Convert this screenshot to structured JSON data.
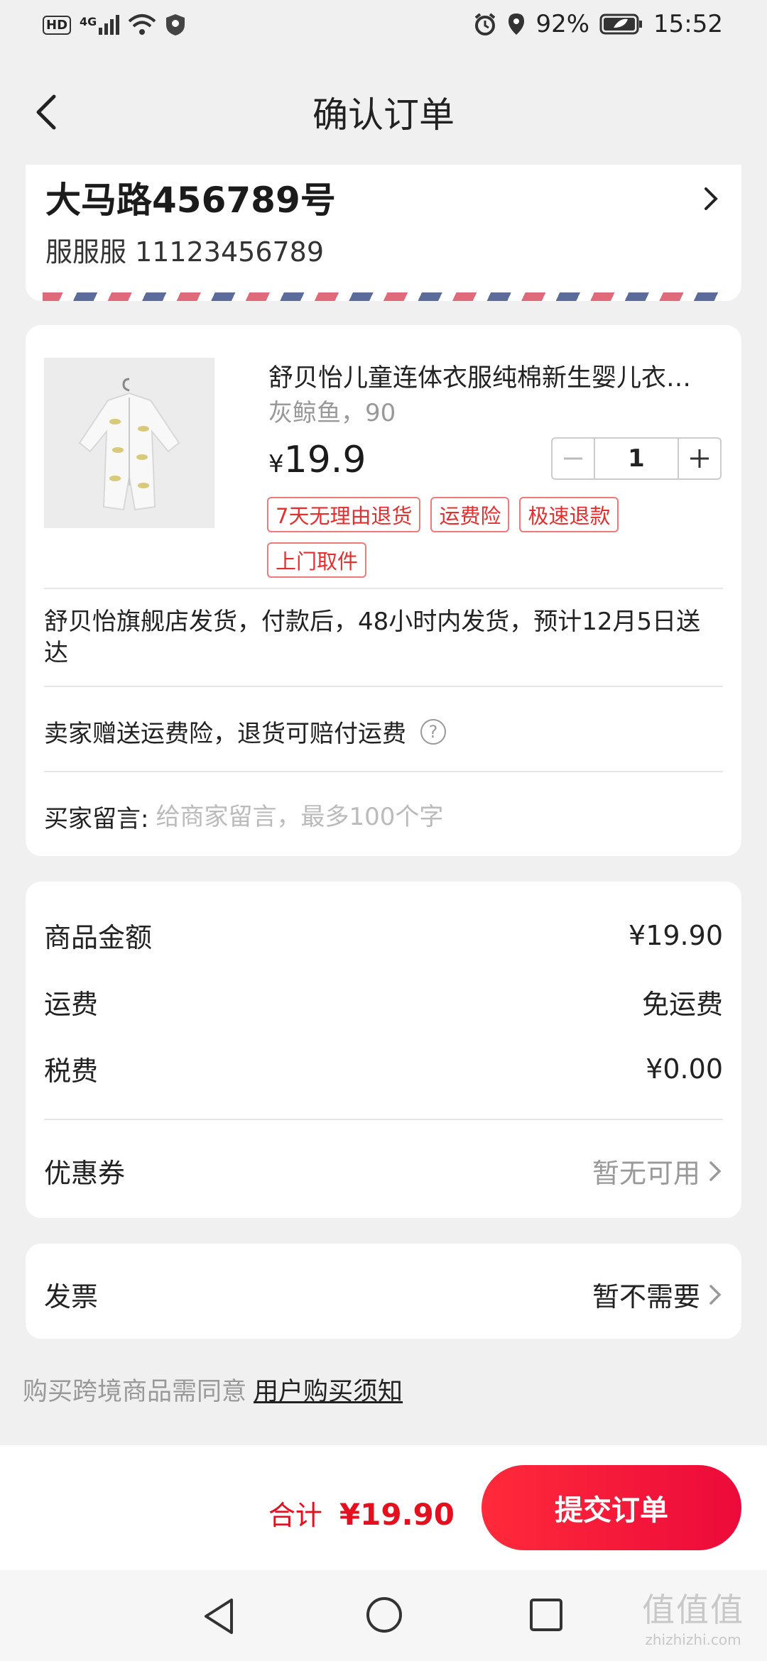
{
  "status_bar": {
    "network": "HD",
    "signal": "4G",
    "battery": "92%",
    "time": "15:52"
  },
  "nav": {
    "title": "确认订单"
  },
  "address": {
    "street": "大马路456789号",
    "recipient": "服服服 11123456789"
  },
  "product": {
    "name": "舒贝怡儿童连体衣服纯棉新生婴儿衣…",
    "spec": "灰鲸鱼，90",
    "currency": "¥",
    "price": "19.9",
    "quantity": "1",
    "tags": [
      "7天无理由退货",
      "运费险",
      "极速退款",
      "上门取件"
    ],
    "shipping_info": "舒贝怡旗舰店发货，付款后，48小时内发货，预计12月5日送达",
    "insurance_note": "卖家赠送运费险，退货可赔付运费",
    "insurance_help": "?",
    "message_label": "买家留言:",
    "message_placeholder": "给商家留言，最多100个字"
  },
  "summary": {
    "goods_label": "商品金额",
    "goods_value": "¥19.90",
    "shipping_label": "运费",
    "shipping_value": "免运费",
    "tax_label": "税费",
    "tax_value": "¥0.00",
    "coupon_label": "优惠券",
    "coupon_value": "暂无可用"
  },
  "invoice": {
    "label": "发票",
    "value": "暂不需要"
  },
  "agreement": {
    "text": "购买跨境商品需同意",
    "link": "用户购买须知"
  },
  "checkout": {
    "total_label": "合计",
    "total_value": "¥19.90",
    "submit_label": "提交订单"
  },
  "watermark": {
    "brand": "值值值",
    "url": "zhizhizhi.com"
  },
  "colors": {
    "accent": "#e4101f",
    "button_start": "#ff2a3a",
    "button_end": "#ec0a3a"
  },
  "icons": [
    "back-arrow-icon",
    "chevron-right-icon",
    "minus-icon",
    "plus-icon",
    "help-icon",
    "nav-back-icon",
    "nav-home-icon",
    "nav-recents-icon"
  ]
}
